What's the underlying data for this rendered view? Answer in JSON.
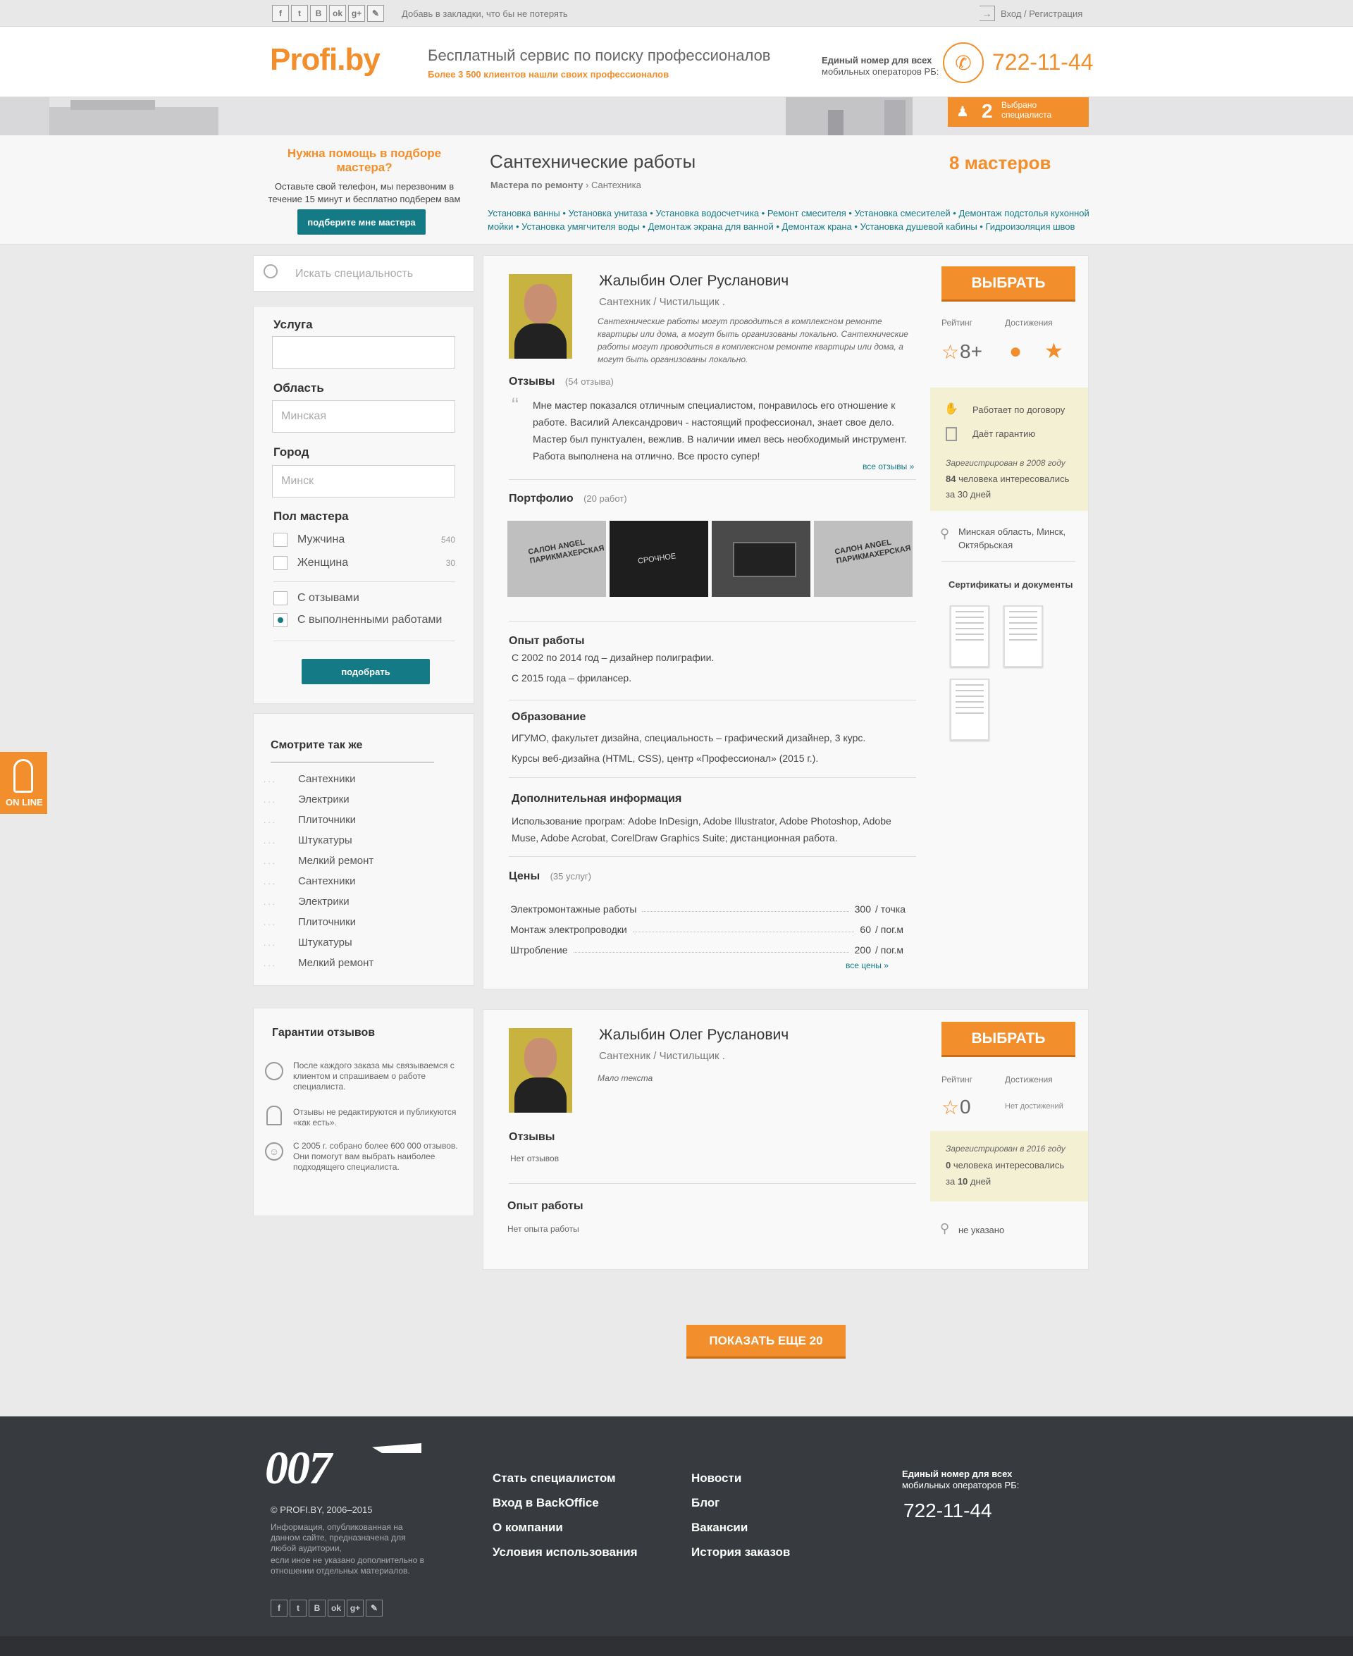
{
  "topbar": {
    "social": [
      "f",
      "t",
      "B",
      "ok",
      "g+",
      "✎"
    ],
    "bookmark": "Добавь в закладки, что бы не потерять",
    "login": "Вход",
    "separator": "/",
    "register": "Регистрация"
  },
  "header": {
    "logo": "Profi.by",
    "slogan": "Бесплатный сервис по поиску профессионалов",
    "subslogan": "Более 3 500 клиентов нашли своих профессионалов",
    "phone_caption_1": "Единый номер для всех",
    "phone_caption_2": "мобильных операторов РБ:",
    "phone": "722-11-44"
  },
  "selected": {
    "count": "2",
    "label_1": "Выбрано",
    "label_2": "специалиста"
  },
  "help": {
    "title": "Нужна помощь в подборе мастера?",
    "text": "Оставьте свой телефон, мы перезвоним в течение 15 минут и бесплатно подберем вам идеального кандидата.",
    "button": "подберите мне мастера"
  },
  "category": {
    "title": "Сантехнические работы",
    "crumb_1": "Мастера по ремонту",
    "crumb_sep": " › ",
    "crumb_2": "Сантехника",
    "count": "8 мастеров",
    "tags_line_1": "Установка ванны • Установка унитаза • Установка водосчетчика • Ремонт смесителя • Установка смесителей • Демонтаж подстолья кухонной",
    "tags_line_2": "мойки • Установка умягчителя воды • Демонтаж экрана для ванной • Демонтаж крана • Установка душевой кабины • Гидроизоляция швов"
  },
  "search": {
    "placeholder": "Искать специальность"
  },
  "filter": {
    "service_label": "Услуга",
    "region_label": "Область",
    "region_value": "Минская",
    "city_label": "Город",
    "city_value": "Минск",
    "gender_label": "Пол мастера",
    "male": "Мужчина",
    "male_count": "540",
    "female": "Женщина",
    "female_count": "30",
    "with_reviews": "С отзывами",
    "with_works": "С выполненными работами",
    "button": "подобрать"
  },
  "see_also": {
    "title": "Смотрите так же",
    "items": [
      "Сантехники",
      "Электрики",
      "Плиточники",
      "Штукатуры",
      "Мелкий ремонт",
      "Сантехники",
      "Электрики",
      "Плиточники",
      "Штукатуры",
      "Мелкий ремонт"
    ]
  },
  "online": "ON LINE",
  "guarantees": {
    "title": "Гарантии отзывов",
    "item_1": "После каждого заказа мы связываемся с клиентом и спрашиваем о работе специалиста.",
    "item_2": "Отзывы не редактируются и публикуются «как есть».",
    "item_3": "С 2005 г. собрано более 600 000 отзывов. Они помогут вам выбрать наиболее подходящего специалиста."
  },
  "master1": {
    "name": "Жалыбин Олег Русланович",
    "prof_1": "Сантехник",
    "prof_2": "Чистильщик",
    "about": "Сантехнические работы могут проводиться в комплексном ремонте квартиры или дома, а могут быть организованы локально. Сантехнические работы могут проводиться в комплексном ремонте квартиры или дома, а могут быть организованы локально.",
    "reviews_title": "Отзывы",
    "reviews_count": "(54 отзыва)",
    "review": "Мне мастер показался отличным специалистом, понравилось его отношение к работе. Василий Александрович - настоящий профессионал, знает свое дело. Мастер был пунктуален, вежлив. В наличии имел весь необходимый инструмент. Работа выполнена на отлично. Все просто супер!",
    "all_reviews": "все отзывы »",
    "portfolio_title": "Портфолио",
    "portfolio_count": "(20 работ)",
    "portfolio_1": "САЛОН ANGEL ПАРИКМАХЕРСКАЯ",
    "portfolio_2": "СРОЧНОЕ",
    "exp_title": "Опыт работы",
    "exp_1": "С 2002 по 2014 год – дизайнер полиграфии.",
    "exp_2": "С 2015 года – фрилансер.",
    "edu_title": "Образование",
    "edu_1": "ИГУМО, факультет дизайна, специальность – графический дизайнер, 3 курс.",
    "edu_2": "Курсы веб-дизайна (HTML, CSS), центр «Профессионал» (2015 г.).",
    "add_title": "Дополнительная информация",
    "add_text": "Использование програм: Adobe InDesign, Adobe Illustrator, Adobe Photoshop, Adobe Muse, Adobe Acrobat, CorelDraw Graphics Suite; дистанционная работа.",
    "prices_title": "Цены",
    "prices_count": "(35 услуг)",
    "prices": [
      {
        "name": "Электромонтажные работы",
        "value": "300",
        "unit": "/ точка"
      },
      {
        "name": "Монтаж электропроводки",
        "value": "60",
        "unit": "/ пог.м"
      },
      {
        "name": "Штробление",
        "value": "200",
        "unit": "/ пог.м"
      }
    ],
    "all_prices": "все цены »",
    "choose": "ВЫБРАТЬ",
    "rating_label": "Рейтинг",
    "rating": "8+",
    "achievements_label": "Достижения",
    "contract": "Работает по договору",
    "guarantee": "Даёт гарантию",
    "registered": "Зарегистрирован в 2008 году",
    "interest_num": "84",
    "interest_text": "человека интересовались",
    "interest_period": "за 30 дней",
    "location": "Минская область, Минск, Октябрьская",
    "certs_title": "Сертификаты и документы"
  },
  "master2": {
    "name": "Жалыбин Олег Русланович",
    "prof_1": "Сантехник",
    "prof_2": "Чистильщик",
    "about": "Мало текста",
    "reviews_title": "Отзывы",
    "no_reviews": "Нет отзывов",
    "exp_title": "Опыт работы",
    "no_exp": "Нет опыта работы",
    "choose": "ВЫБРАТЬ",
    "rating_label": "Рейтинг",
    "rating": "0",
    "achievements_label": "Достижения",
    "no_achievements": "Нет достижений",
    "registered": "Зарегистрирован в 2016 году",
    "interest_num": "0",
    "interest_text": "человека интересовались",
    "interest_period_pre": "за",
    "interest_period_num": "10",
    "interest_period_post": "дней",
    "location": "не указано"
  },
  "show_more": "ПОКАЗАТЬ ЕЩЕ 20",
  "footer": {
    "logo": "007",
    "copyright": "© PROFI.BY, 2006–2015",
    "disclaimer_1": "Информация, опубликованная на данном сайте, предназначена для любой аудитории,",
    "disclaimer_2": "если иное не указано дополнительно в отношении отдельных материалов.",
    "col1": [
      "Стать специалистом",
      "Вход в BackOffice",
      "О компании",
      "Условия использования"
    ],
    "col2": [
      "Новости",
      "Блог",
      "Вакансии",
      "История заказов"
    ],
    "phone_caption_1": "Единый номер для всех",
    "phone_caption_2": "мобильных операторов РБ:",
    "phone": "722-11-44"
  }
}
